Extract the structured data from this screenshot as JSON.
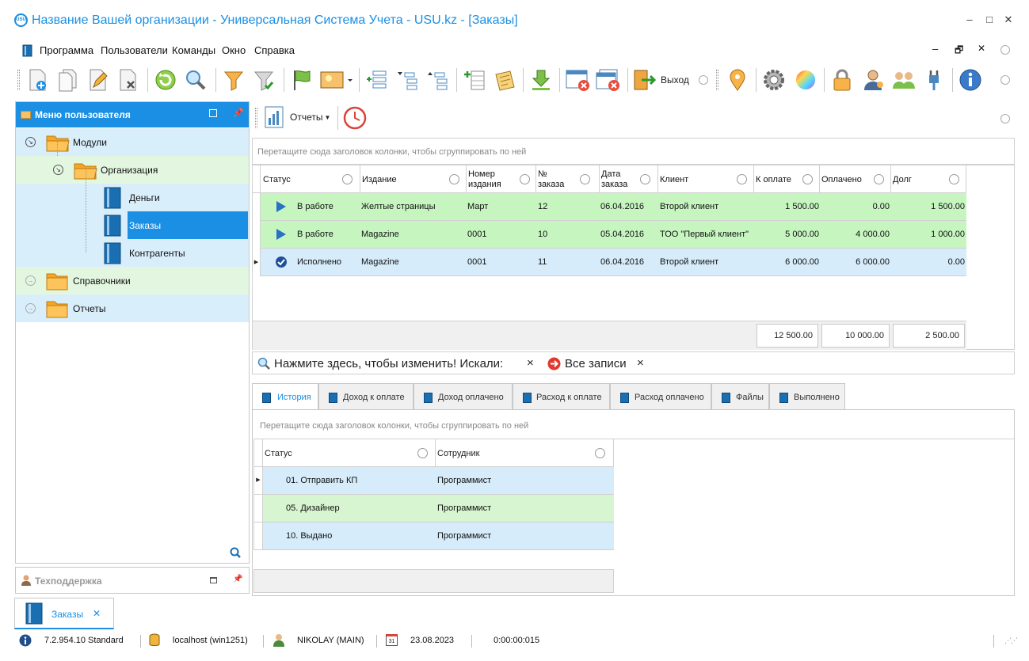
{
  "window": {
    "logo": "USU",
    "title": "Название Вашей организации - Универсальная Система Учета - USU.kz - [Заказы]",
    "minimize": "–",
    "maximize": "□",
    "close": "✕"
  },
  "menu": {
    "items": [
      "Программа",
      "Пользователи",
      "Команды",
      "Окно",
      "Справка"
    ],
    "mdi_controls": [
      "–",
      "🗗",
      "✕"
    ]
  },
  "toolbar": {
    "exit_label": "Выход"
  },
  "left_panel": {
    "title": "Меню пользователя",
    "tree": [
      {
        "label": "Модули",
        "level": 0,
        "expander": "collapse"
      },
      {
        "label": "Организация",
        "level": 1,
        "expander": "collapse"
      },
      {
        "label": "Деньги",
        "level": 2
      },
      {
        "label": "Заказы",
        "level": 2,
        "selected": true
      },
      {
        "label": "Контрагенты",
        "level": 2
      },
      {
        "label": "Справочники",
        "level": 0,
        "expander": "expand"
      },
      {
        "label": "Отчеты",
        "level": 0,
        "expander": "expand"
      }
    ]
  },
  "support_panel": {
    "title": "Техподдержка"
  },
  "reports_toolbar": {
    "reports_label": "Отчеты"
  },
  "main_grid": {
    "group_hint": "Перетащите сюда заголовок колонки, чтобы сгруппировать по ней",
    "columns": [
      "Статус",
      "Издание",
      "Номер издания",
      "№ заказа",
      "Дата заказа",
      "Клиент",
      "К оплате",
      "Оплачено",
      "Долг"
    ],
    "column_lines": [
      [
        "Статус"
      ],
      [
        "Издание"
      ],
      [
        "Номер",
        "издания"
      ],
      [
        "№",
        "заказа"
      ],
      [
        "Дата",
        "заказа"
      ],
      [
        "Клиент"
      ],
      [
        "К оплате"
      ],
      [
        "Оплачено"
      ],
      [
        "Долг"
      ]
    ],
    "rows": [
      {
        "status": "В работе",
        "icon": "play-icon",
        "edition": "Желтые страницы",
        "edition_no": "Март",
        "order_no": "12",
        "date": "06.04.2016",
        "client": "Второй клиент",
        "to_pay": "1 500.00",
        "paid": "0.00",
        "debt": "1 500.00",
        "color": "#c6f5c0"
      },
      {
        "status": "В работе",
        "icon": "play-icon",
        "edition": "Magazine",
        "edition_no": "0001",
        "order_no": "10",
        "date": "05.04.2016",
        "client": "ТОО \"Первый клиент\"",
        "to_pay": "5 000.00",
        "paid": "4 000.00",
        "debt": "1 000.00",
        "color": "#c6f5c0"
      },
      {
        "status": "Исполнено",
        "icon": "check-icon",
        "edition": "Magazine",
        "edition_no": "0001",
        "order_no": "11",
        "date": "06.04.2016",
        "client": "Второй клиент",
        "to_pay": "6 000.00",
        "paid": "6 000.00",
        "debt": "0.00",
        "color": "#d6ecfa"
      }
    ],
    "totals": {
      "to_pay": "12 500.00",
      "paid": "10 000.00",
      "debt": "2 500.00"
    }
  },
  "filter_bar": {
    "text": "Нажмите здесь, чтобы изменить! Искали:",
    "all_records": "Все записи",
    "clear": "×"
  },
  "tabs": [
    "История",
    "Доход к оплате",
    "Доход оплачено",
    "Расход к оплате",
    "Расход оплачено",
    "Файлы",
    "Выполнено"
  ],
  "detail_grid": {
    "group_hint": "Перетащите сюда заголовок колонки, чтобы сгруппировать по ней",
    "columns": [
      "Статус",
      "Сотрудник"
    ],
    "rows": [
      {
        "status": "01. Отправить КП",
        "employee": "Программист",
        "color": "#d6ecfa"
      },
      {
        "status": "05. Дизайнер",
        "employee": "Программист",
        "color": "#d7f5d0"
      },
      {
        "status": "10. Выдано",
        "employee": "Программист",
        "color": "#d6ecfa"
      }
    ]
  },
  "doc_tab": {
    "label": "Заказы",
    "close": "✕"
  },
  "status_bar": {
    "version": "7.2.954.10 Standard",
    "server": "localhost (win1251)",
    "user": "NIKOLAY (MAIN)",
    "calendar_day": "31",
    "date": "23.08.2023",
    "timer": "0:00:00:015"
  },
  "colors": {
    "accent": "#1a8fe3",
    "row_green": "#c6f5c0",
    "row_blue": "#d6ecfa",
    "tree_blue": "#d9eefb",
    "tree_green": "#e3f7e0"
  }
}
